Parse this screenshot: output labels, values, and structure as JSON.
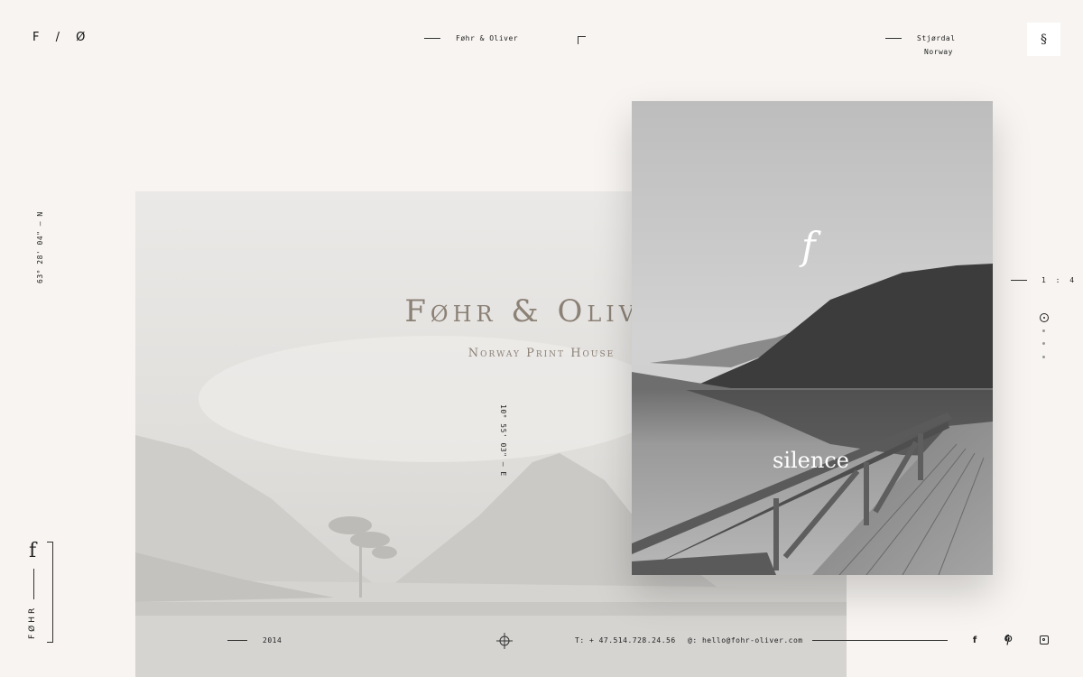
{
  "header": {
    "logo": "F / Ø",
    "brand": "Føhr & Oliver",
    "city": "Stjørdal",
    "country": "Norway",
    "menu_icon": "s-icon"
  },
  "coordinates": {
    "latitude": "63° 28' 04\" — N",
    "longitude": "10° 55' 03\" — E"
  },
  "hero": {
    "title": "Føhr & Oliver",
    "subtitle": "Norway Print House"
  },
  "card": {
    "monogram": "f",
    "word": "silence"
  },
  "pager": {
    "label": "1 : 4",
    "current": 1,
    "total": 4
  },
  "side_brand": {
    "monogram": "f",
    "word": "FØHR"
  },
  "footer": {
    "year": "2014",
    "phone": "T: + 47.514.728.24.56",
    "email": "@: hello@fohr-oliver.com"
  },
  "social": [
    "facebook-icon",
    "pinterest-icon",
    "instagram-icon"
  ],
  "colors": {
    "background": "#f7f4f1",
    "title": "#8b8176",
    "text": "#222222"
  }
}
